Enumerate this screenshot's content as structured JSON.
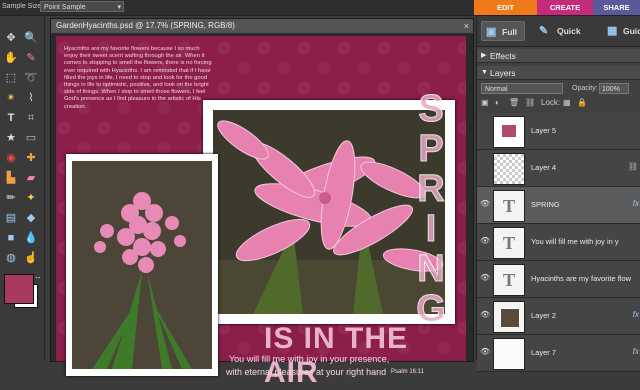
{
  "options_bar": {
    "label": "Sample Size:",
    "value": "Point Sample"
  },
  "mode_tabs": [
    "EDIT",
    "CREATE",
    "SHARE"
  ],
  "document": {
    "title": "GardenHyacinths.psd @ 17.7% (SPRING, RGB/8)",
    "journal": "Hyacinths are my favorite flowers because I so much enjoy their sweet scent wafting through the air. When it comes to stopping to smell the flowers, there is no forcing ever required with Hyacinths. I am reminded that if I have filled the joys in life, I need to stop and look for the good things in life to optimistic, positive, and look on the bright side of things. When I stop to smell those flowers, I feel God's presence as I find pleasure in the artistic of His creation.",
    "spring_text": "SPRING",
    "air_text": "IS IN THE AIR",
    "verse_line1": "You will fill me with joy in your presence,",
    "verse_line2": "with eternal pleasures at your right hand",
    "verse_ref": "Psalm 16:11"
  },
  "panel": {
    "tabs": [
      "Full",
      "Quick",
      "Guided"
    ],
    "effects_label": "Effects",
    "layers_label": "Layers",
    "blend_mode": "Normal",
    "opacity_label": "Opacity:",
    "opacity_value": "100%",
    "lock_label": "Lock:",
    "layers": [
      {
        "name": "Layer 5",
        "type": "image",
        "fx": ""
      },
      {
        "name": "Layer 4",
        "type": "checker",
        "fx": "link"
      },
      {
        "name": "SPRING",
        "type": "text",
        "fx": "fx"
      },
      {
        "name": "You will fill me with joy in y",
        "type": "text",
        "fx": ""
      },
      {
        "name": "Hyacinths are my favorite flow",
        "type": "text",
        "fx": ""
      },
      {
        "name": "Layer 2",
        "type": "photo",
        "fx": "fx"
      },
      {
        "name": "Layer 7",
        "type": "white",
        "fx": "fx"
      }
    ]
  },
  "colors": {
    "foreground": "#a83a5e",
    "background": "#ffffff",
    "edit_tab": "#f07a1a",
    "create_tab": "#c42b7a",
    "share_tab": "#5a5a9a"
  }
}
